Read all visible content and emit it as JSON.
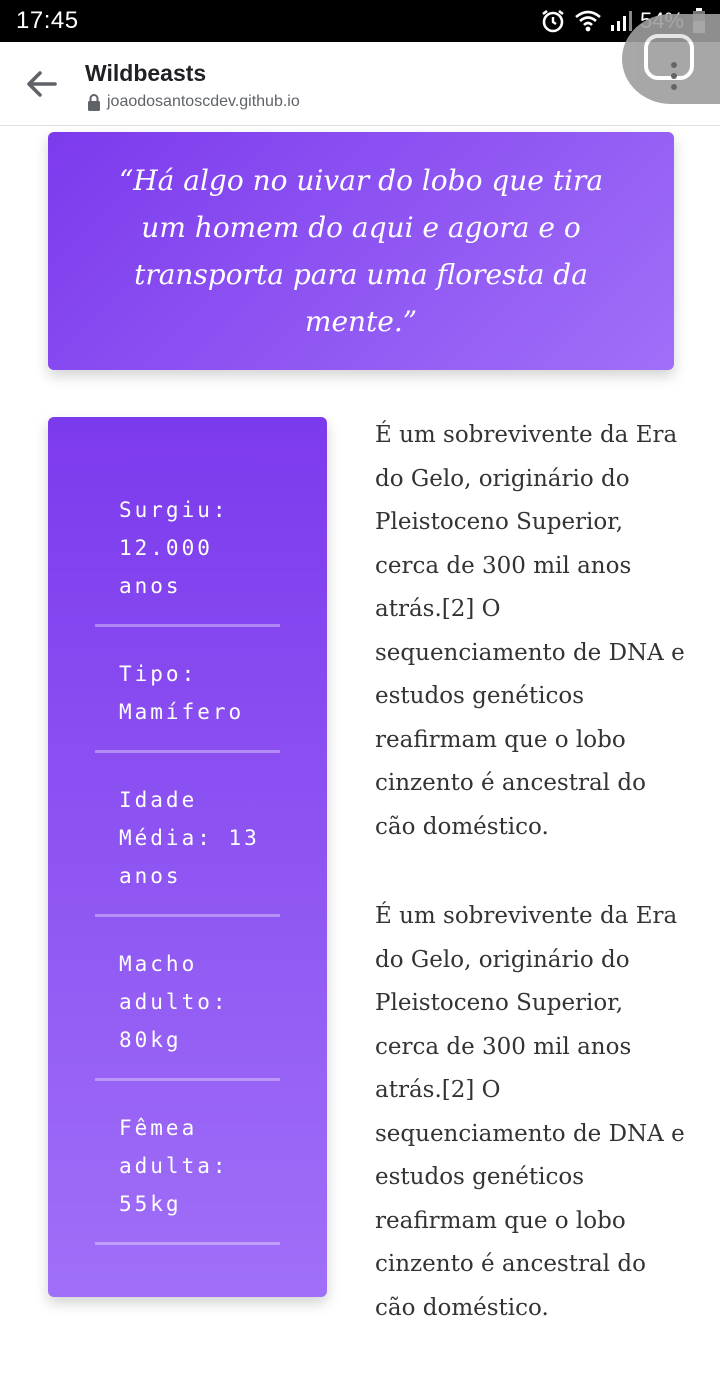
{
  "status_bar": {
    "time": "17:45",
    "battery": "54%",
    "icons": [
      "alarm-icon",
      "wifi-icon",
      "signal-icon",
      "battery-icon"
    ]
  },
  "app_bar": {
    "title": "Wildbeasts",
    "url": "joaodosantoscdev.github.io"
  },
  "quote": {
    "text": "“Há algo no uivar do lobo que tira um homem do aqui e agora e o transporta para uma floresta da mente.”"
  },
  "info": {
    "items": [
      {
        "text": "Surgiu: 12.000 anos"
      },
      {
        "text": "Tipo: Mamífero"
      },
      {
        "text": "Idade Média: 13 anos"
      },
      {
        "text": "Macho adulto: 80kg"
      },
      {
        "text": "Fêmea adulta: 55kg"
      }
    ]
  },
  "body": {
    "paragraphs": [
      "É um sobrevivente da Era do Gelo, originário do Pleistoceno Superior, cerca de 300 mil anos atrás.[2] O sequenciamento de DNA e estudos genéticos reafirmam que o lobo cinzento é ancestral do cão doméstico.",
      "É um sobrevivente da Era do Gelo, originário do Pleistoceno Superior, cerca de 300 mil anos atrás.[2] O sequenciamento de DNA e estudos genéticos reafirmam que o lobo cinzento é ancestral do cão doméstico."
    ]
  },
  "colors": {
    "accent_start": "#7c3aed",
    "accent_end": "#a06ff8"
  }
}
